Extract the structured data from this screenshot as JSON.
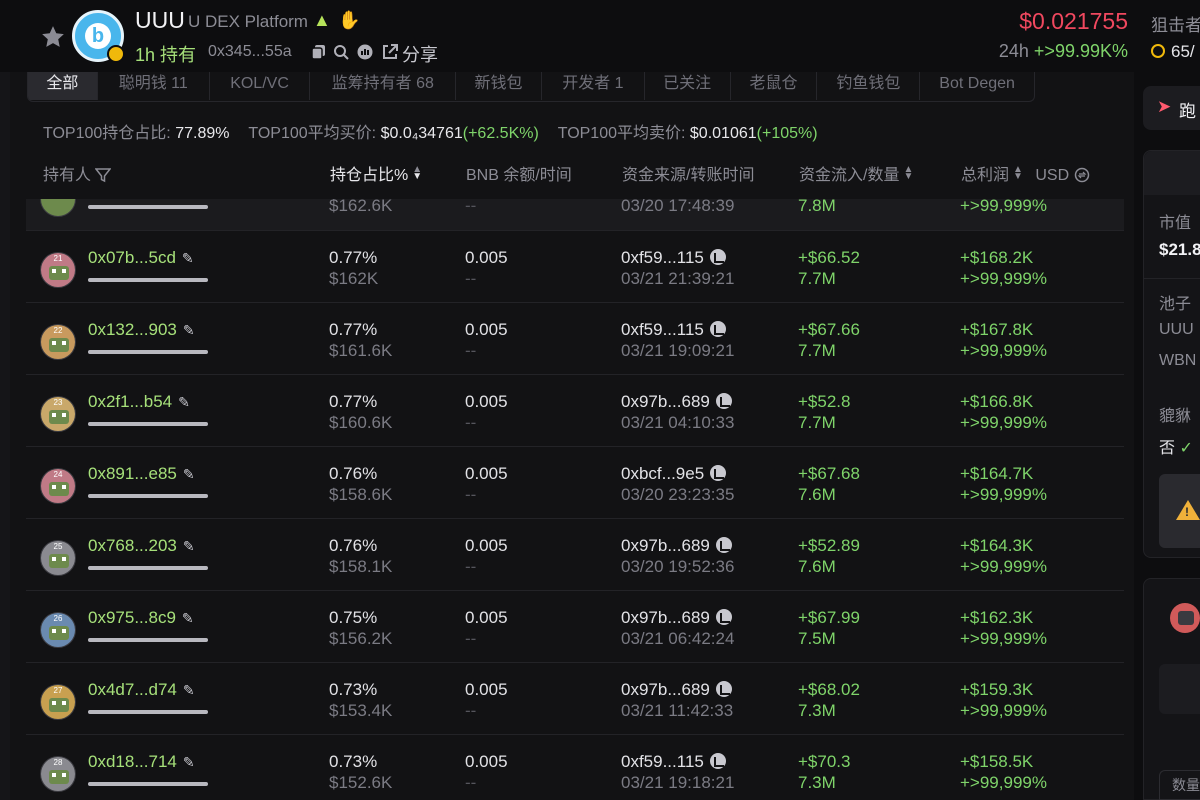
{
  "header": {
    "token_symbol": "UUU",
    "platform": "U DEX Platform",
    "age": "1h 持有",
    "contract": "0x345...55a",
    "share_label": "分享",
    "price": "$0.021755",
    "change_label": "24h",
    "change_value": "+>99.99K%",
    "sniper_label": "狙击者",
    "sniper_value": "65/"
  },
  "tabs": [
    {
      "label": "全部",
      "active": true
    },
    {
      "label": "聪明钱 11",
      "active": false
    },
    {
      "label": "KOL/VC",
      "active": false
    },
    {
      "label": "监筹持有者 68",
      "active": false
    },
    {
      "label": "新钱包",
      "active": false
    },
    {
      "label": "开发者 1",
      "active": false
    },
    {
      "label": "已关注",
      "active": false
    },
    {
      "label": "老鼠仓",
      "active": false
    },
    {
      "label": "钓鱼钱包",
      "active": false
    },
    {
      "label": "Bot Degen",
      "active": false
    }
  ],
  "stats": {
    "hold_label": "TOP100持仓占比:",
    "hold_value": "77.89%",
    "buy_label": "TOP100平均买价:",
    "buy_value": "$0.0₄34761",
    "buy_change": "(+62.5K%)",
    "sell_label": "TOP100平均卖价:",
    "sell_value": "$0.01061",
    "sell_change": "(+105%)"
  },
  "columns": {
    "holder": "持有人",
    "share": "持仓占比%",
    "bnb": "BNB 余额/时间",
    "source": "资金来源/转账时间",
    "inflow": "资金流入/数量",
    "profit": "总利润",
    "currency": "USD"
  },
  "top_partial_row": {
    "value_usd": "$162.6K",
    "bnb": "--",
    "time": "03/20 17:48:39",
    "qty": "7.8M",
    "profit_pct": "+>99,999%"
  },
  "rows": [
    {
      "rank": "21",
      "address": "0x07b...5cd",
      "share": "0.77%",
      "value_usd": "$162K",
      "bnb": "0.005",
      "bnb_time": "--",
      "source": "0xf59...115",
      "time": "03/21 21:39:21",
      "inflow": "+$66.52",
      "qty": "7.7M",
      "profit": "+$168.2K",
      "profit_pct": "+>99,999%",
      "avatar_color": "#c07a86"
    },
    {
      "rank": "22",
      "address": "0x132...903",
      "share": "0.77%",
      "value_usd": "$161.6K",
      "bnb": "0.005",
      "bnb_time": "--",
      "source": "0xf59...115",
      "time": "03/21 19:09:21",
      "inflow": "+$67.66",
      "qty": "7.7M",
      "profit": "+$167.8K",
      "profit_pct": "+>99,999%",
      "avatar_color": "#c89a5e"
    },
    {
      "rank": "23",
      "address": "0x2f1...b54",
      "share": "0.77%",
      "value_usd": "$160.6K",
      "bnb": "0.005",
      "bnb_time": "--",
      "source": "0x97b...689",
      "time": "03/21 04:10:33",
      "inflow": "+$52.8",
      "qty": "7.7M",
      "profit": "+$166.8K",
      "profit_pct": "+>99,999%",
      "avatar_color": "#c9a86a"
    },
    {
      "rank": "24",
      "address": "0x891...e85",
      "share": "0.76%",
      "value_usd": "$158.6K",
      "bnb": "0.005",
      "bnb_time": "--",
      "source": "0xbcf...9e5",
      "time": "03/20 23:23:35",
      "inflow": "+$67.68",
      "qty": "7.6M",
      "profit": "+$164.7K",
      "profit_pct": "+>99,999%",
      "avatar_color": "#c07a86"
    },
    {
      "rank": "25",
      "address": "0x768...203",
      "share": "0.76%",
      "value_usd": "$158.1K",
      "bnb": "0.005",
      "bnb_time": "--",
      "source": "0x97b...689",
      "time": "03/20 19:52:36",
      "inflow": "+$52.89",
      "qty": "7.6M",
      "profit": "+$164.3K",
      "profit_pct": "+>99,999%",
      "avatar_color": "#8a8a90"
    },
    {
      "rank": "26",
      "address": "0x975...8c9",
      "share": "0.75%",
      "value_usd": "$156.2K",
      "bnb": "0.005",
      "bnb_time": "--",
      "source": "0x97b...689",
      "time": "03/21 06:42:24",
      "inflow": "+$67.99",
      "qty": "7.5M",
      "profit": "+$162.3K",
      "profit_pct": "+>99,999%",
      "avatar_color": "#6a8ab0"
    },
    {
      "rank": "27",
      "address": "0x4d7...d74",
      "share": "0.73%",
      "value_usd": "$153.4K",
      "bnb": "0.005",
      "bnb_time": "--",
      "source": "0x97b...689",
      "time": "03/21 11:42:33",
      "inflow": "+$68.02",
      "qty": "7.3M",
      "profit": "+$159.3K",
      "profit_pct": "+>99,999%",
      "avatar_color": "#c8a050"
    },
    {
      "rank": "28",
      "address": "0xd18...714",
      "share": "0.73%",
      "value_usd": "$152.6K",
      "bnb": "0.005",
      "bnb_time": "--",
      "source": "0xf59...115",
      "time": "03/21 19:18:21",
      "inflow": "+$70.3",
      "qty": "7.3M",
      "profit": "+$158.5K",
      "profit_pct": "+>99,999%",
      "avatar_color": "#8a8a90"
    }
  ],
  "sidebar": {
    "run_label": "跑",
    "market_cap_label": "市值",
    "market_cap_value": "$21.8",
    "pool_label": "池子",
    "pool_token_a": "UUU",
    "pool_token_b": "WBN",
    "honeypot_label": "貔貅",
    "honeypot_value": "否",
    "bottom_label": "数量"
  },
  "colors": {
    "accent_green": "#7fd46a",
    "address_green": "#a6e07a",
    "price_red": "#f0485f",
    "warning": "#f0b13a",
    "background": "#0d0d0f"
  },
  "icons": [
    "star-icon",
    "fire-icon",
    "hand-icon",
    "copy-icon",
    "search-icon",
    "coin-icon",
    "share-icon",
    "filter-icon",
    "sort-icon",
    "edit-icon",
    "run-icon",
    "warning-icon"
  ]
}
